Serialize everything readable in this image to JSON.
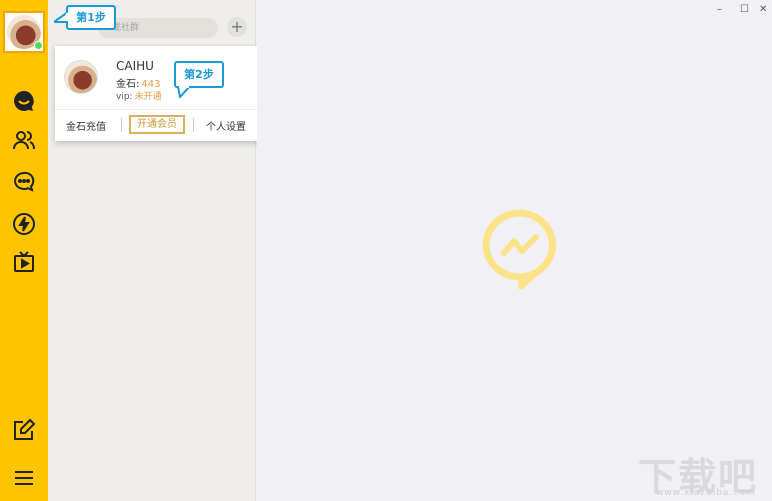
{
  "sidebar": {
    "icons": [
      "chat-bubble-icon",
      "contacts-icon",
      "messages-icon",
      "lightning-icon",
      "tv-icon",
      "edit-icon",
      "menu-icon"
    ]
  },
  "panel": {
    "search_placeholder": "或社群",
    "add_label": "+"
  },
  "popup": {
    "username": "CAIHU",
    "gold_label": "金石:",
    "gold_value": "443",
    "vip_label": "vip:",
    "vip_value": "未开通",
    "actions": {
      "recharge": "金石充值",
      "open_vip": "开通会员",
      "settings": "个人设置"
    }
  },
  "callouts": {
    "step1": "第1步",
    "step2": "第2步"
  },
  "window": {
    "minimize": "–",
    "maximize": "☐",
    "close": "✕"
  },
  "watermark": {
    "big": "下载吧",
    "small": "www.xiazaiba.com"
  },
  "colors": {
    "sidebar": "#ffc400",
    "accent_gold": "#e59a3f",
    "callout_blue": "#1a9ad6",
    "logo_yellow": "#fbe38a"
  }
}
